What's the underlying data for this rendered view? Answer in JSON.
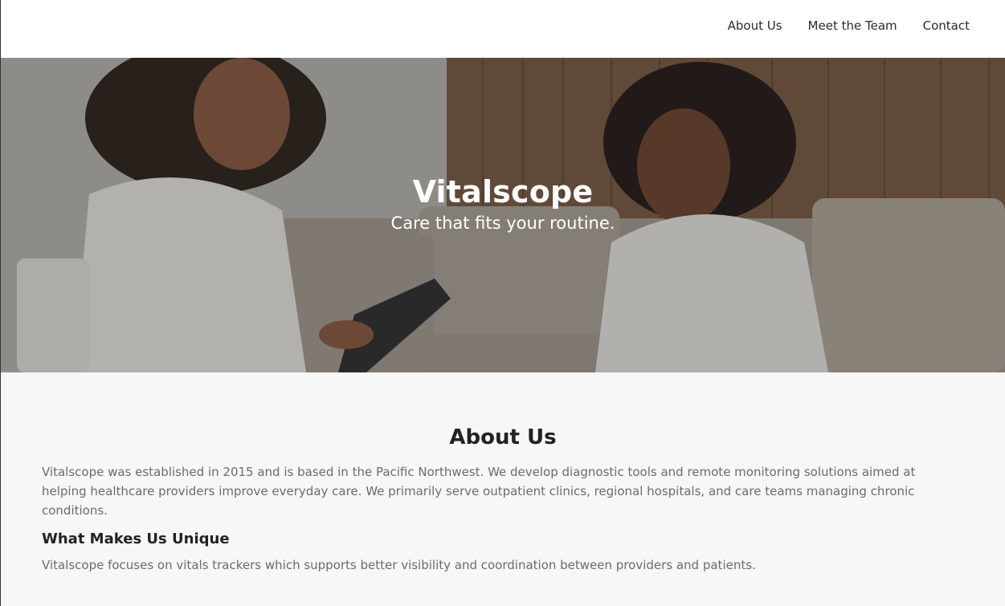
{
  "nav": {
    "links": [
      "About Us",
      "Meet the Team",
      "Contact"
    ]
  },
  "hero": {
    "title": "Vitalscope",
    "subtitle": "Care that fits your routine.",
    "image": "photo-two-women-consultation-on-sofa",
    "overlay_color": "#1e1c1a"
  },
  "about": {
    "title": "About Us",
    "paragraph": "Vitalscope was established in 2015 and is based in the Pacific Northwest. We develop diagnostic tools and remote monitoring solutions aimed at helping healthcare providers improve everyday care. We primarily serve outpatient clinics, regional hospitals, and care teams managing chronic conditions.",
    "unique_heading": "What Makes Us Unique",
    "unique_paragraph": "Vitalscope focuses on vitals trackers which supports better visibility and coordination between providers and patients."
  },
  "colors": {
    "section_background": "#f7f7f7",
    "body_text": "#6b6b6b",
    "heading_text": "#222222"
  }
}
